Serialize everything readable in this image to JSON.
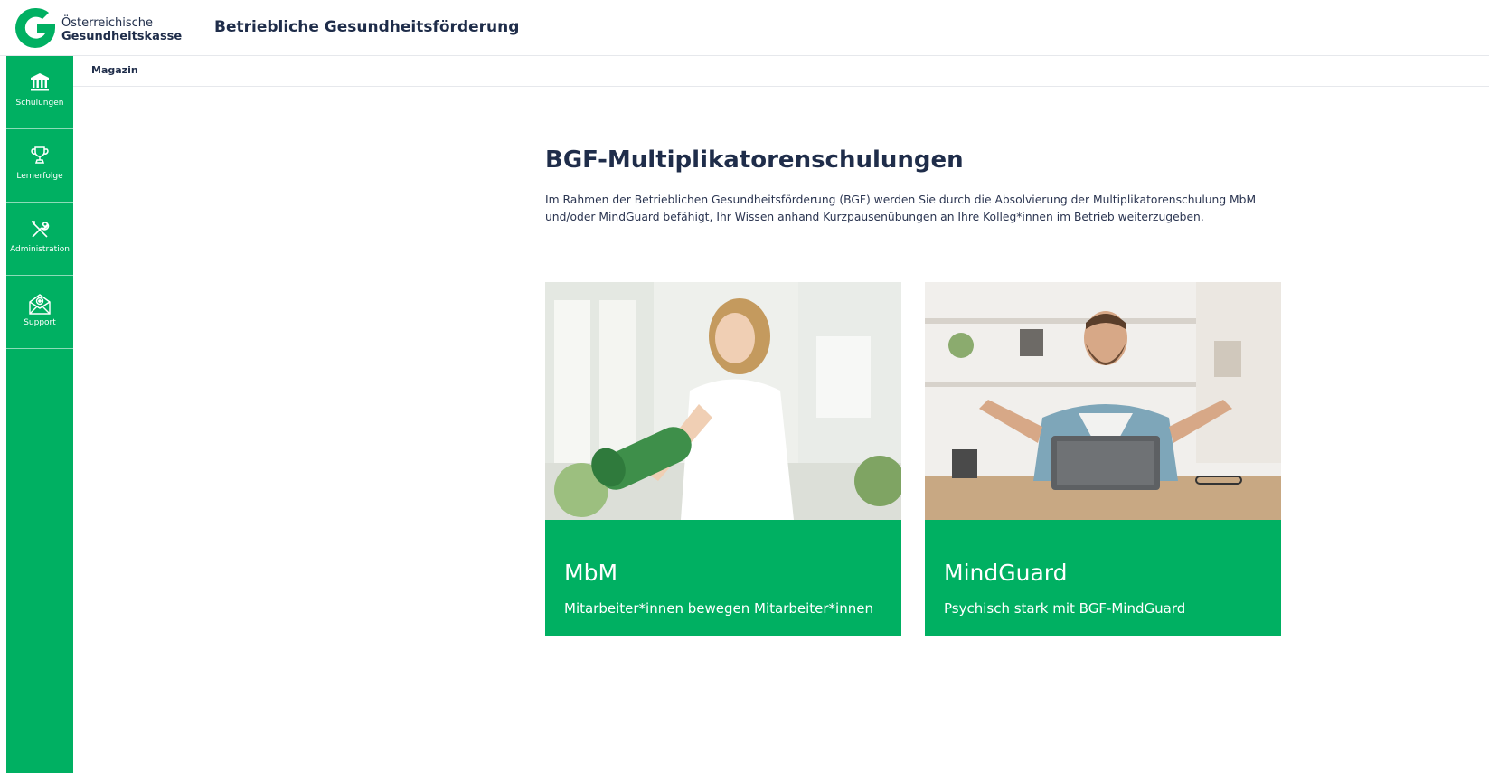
{
  "header": {
    "logo_line1": "Österreichische",
    "logo_line2": "Gesundheitskasse",
    "app_title": "Betriebliche Gesundheitsförderung"
  },
  "sidebar": {
    "items": [
      {
        "label": "Schulungen",
        "icon": "bank-icon"
      },
      {
        "label": "Lernerfolge",
        "icon": "trophy-icon"
      },
      {
        "label": "Administration",
        "icon": "tools-icon"
      },
      {
        "label": "Support",
        "icon": "mail-support-icon"
      }
    ]
  },
  "breadcrumb": {
    "item": "Magazin"
  },
  "main": {
    "title": "BGF-Multiplikatorenschulungen",
    "intro": "Im Rahmen der Betrieblichen Gesundheitsförderung (BGF) werden Sie durch die Absolvierung der Multiplikatorenschulung MbM und/oder MindGuard befähigt, Ihr Wissen anhand Kurzpausenübungen an Ihre Kolleg*innen im Betrieb weiterzugeben.",
    "cards": [
      {
        "title": "MbM",
        "subtitle": "Mitarbeiter*innen bewegen Mitarbeiter*innen"
      },
      {
        "title": "MindGuard",
        "subtitle": "Psychisch stark mit BGF-MindGuard"
      }
    ]
  },
  "colors": {
    "brand_green": "#00b062",
    "text_navy": "#1f2d4a"
  }
}
